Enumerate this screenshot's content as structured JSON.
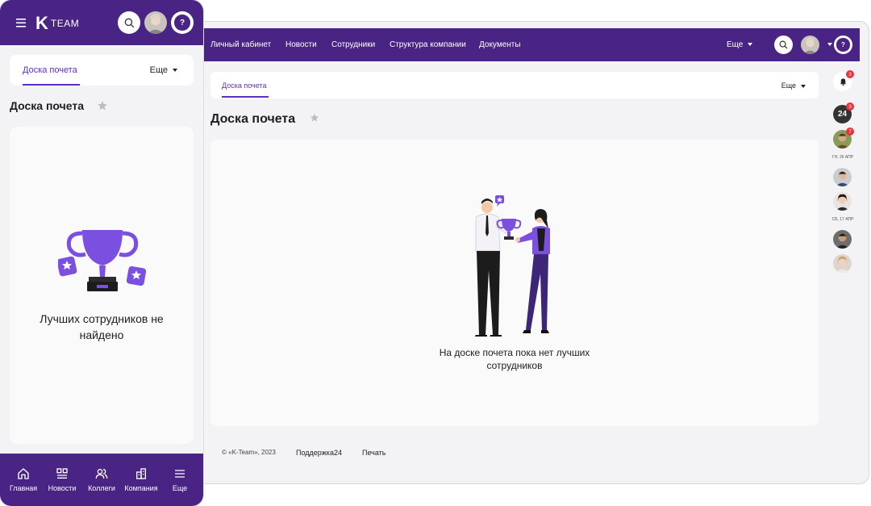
{
  "colors": {
    "brand": "#4a2485",
    "accent": "#5b2fc4",
    "badge": "#e8323a"
  },
  "desktop": {
    "nav": {
      "items": [
        "Личный кабинет",
        "Новости",
        "Сотрудники",
        "Структура компании",
        "Документы"
      ],
      "more": "Еще"
    },
    "tabs": {
      "active": "Доска почета",
      "more": "Еще"
    },
    "page_title": "Доска почета",
    "empty_line1": "На доске почета пока нет лучших",
    "empty_line2": "сотрудников",
    "footer": {
      "copyright": "© «K-Team», 2023",
      "support": "Поддержка24",
      "print": "Печать"
    },
    "right_sidebar": {
      "bell_count": "3",
      "chat_count": "3",
      "contact_count": "7",
      "app_label": "24",
      "date1": "ГН, 26 АПР",
      "date2": "СБ, 17 АПР"
    }
  },
  "mobile": {
    "logo_letter": "K",
    "logo_text": "TEAM",
    "tabs": {
      "active": "Доска почета",
      "more": "Еще"
    },
    "page_title": "Доска почета",
    "empty_line1": "Лучших сотрудников не",
    "empty_line2": "найдено",
    "bottom_nav": [
      "Главная",
      "Новости",
      "Коллеги",
      "Компания",
      "Еще"
    ]
  }
}
